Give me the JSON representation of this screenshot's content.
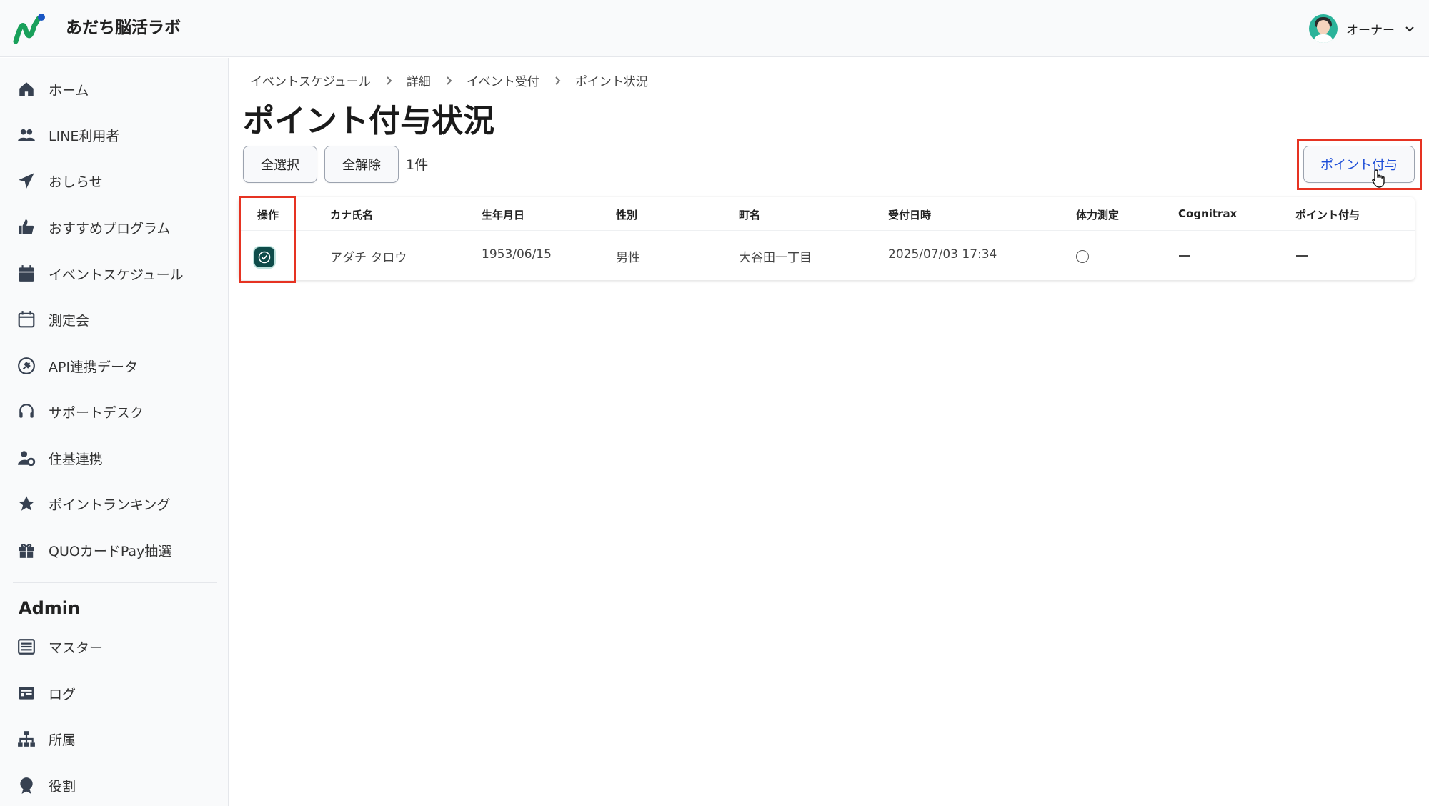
{
  "app": {
    "title": "あだち脳活ラボ"
  },
  "user": {
    "name": "オーナー"
  },
  "sidebar": {
    "items": [
      {
        "label": "ホーム",
        "icon": "home-icon"
      },
      {
        "label": "LINE利用者",
        "icon": "users-icon"
      },
      {
        "label": "おしらせ",
        "icon": "paper-plane-icon"
      },
      {
        "label": "おすすめプログラム",
        "icon": "thumbs-up-icon"
      },
      {
        "label": "イベントスケジュール",
        "icon": "calendar-icon"
      },
      {
        "label": "測定会",
        "icon": "calendar-outline-icon"
      },
      {
        "label": "API連携データ",
        "icon": "plug-icon"
      },
      {
        "label": "サポートデスク",
        "icon": "headset-icon"
      },
      {
        "label": "住基連携",
        "icon": "user-gear-icon"
      },
      {
        "label": "ポイントランキング",
        "icon": "star-icon"
      },
      {
        "label": "QUOカードPay抽選",
        "icon": "gift-icon"
      }
    ],
    "admin_title": "Admin",
    "admin_items": [
      {
        "label": "マスター",
        "icon": "list-icon"
      },
      {
        "label": "ログ",
        "icon": "log-icon"
      },
      {
        "label": "所属",
        "icon": "sitemap-icon"
      },
      {
        "label": "役割",
        "icon": "badge-icon"
      }
    ]
  },
  "breadcrumb": [
    "イベントスケジュール",
    "詳細",
    "イベント受付",
    "ポイント状況"
  ],
  "page": {
    "title": "ポイント付与状況",
    "select_all_label": "全選択",
    "deselect_all_label": "全解除",
    "count_label": "1件",
    "grant_button_label": "ポイント付与"
  },
  "table": {
    "headers": [
      "操作",
      "カナ氏名",
      "生年月日",
      "性別",
      "町名",
      "受付日時",
      "体力測定",
      "Cognitrax",
      "ポイント付与"
    ],
    "rows": [
      {
        "checked": true,
        "kana_name": "アダチ タロウ",
        "birthdate": "1953/06/15",
        "gender": "男性",
        "town": "大谷田一丁目",
        "reception_datetime": "2025/07/03 17:34",
        "physical_test": "circle",
        "cognitrax": "dash",
        "points": "dash"
      }
    ]
  },
  "colors": {
    "accent": "#1d4ed8",
    "checkbox": "#0f4c4a",
    "highlight": "#e63322",
    "logo_green": "#19a05a",
    "logo_blue": "#1a56c4"
  }
}
